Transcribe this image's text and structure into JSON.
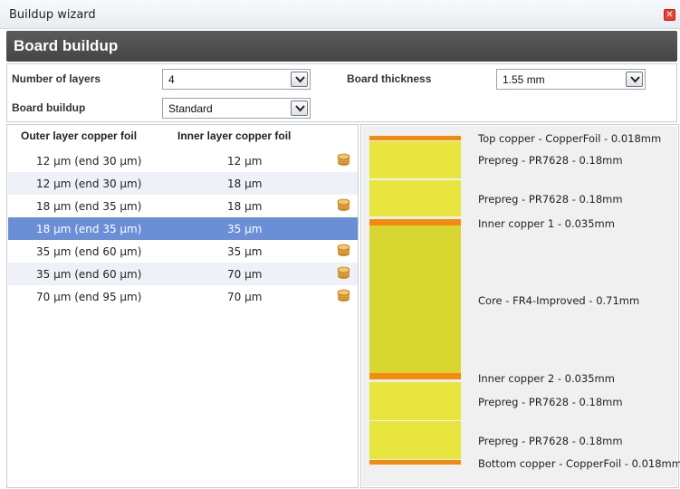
{
  "window": {
    "title": "Buildup wizard",
    "close_icon": "close-icon"
  },
  "header": {
    "title": "Board buildup"
  },
  "settings": {
    "layers_label": "Number of layers",
    "layers_value": "4",
    "thickness_label": "Board thickness",
    "thickness_value": "1.55 mm",
    "buildup_label": "Board buildup",
    "buildup_value": "Standard"
  },
  "table": {
    "headers": [
      "Outer layer copper foil",
      "Inner layer copper foil"
    ],
    "rows": [
      {
        "outer": "12 µm (end 30 µm)",
        "inner": "12 µm",
        "coin": true,
        "selected": false
      },
      {
        "outer": "12 µm (end 30 µm)",
        "inner": "18 µm",
        "coin": false,
        "selected": false
      },
      {
        "outer": "18 µm (end 35 µm)",
        "inner": "18 µm",
        "coin": true,
        "selected": false
      },
      {
        "outer": "18 µm (end 35 µm)",
        "inner": "35 µm",
        "coin": false,
        "selected": true
      },
      {
        "outer": "35 µm (end 60 µm)",
        "inner": "35 µm",
        "coin": true,
        "selected": false
      },
      {
        "outer": "35 µm (end 60 µm)",
        "inner": "70 µm",
        "coin": true,
        "selected": false
      },
      {
        "outer": "70 µm (end 95 µm)",
        "inner": "70 µm",
        "coin": true,
        "selected": false
      }
    ]
  },
  "stackup": {
    "colors": {
      "copper": "#f58a11",
      "prepreg": "#e7e53e",
      "core": "#d8d631"
    },
    "layers": [
      "Top copper - CopperFoil - 0.018mm",
      "Prepreg - PR7628 - 0.18mm",
      "Prepreg - PR7628 - 0.18mm",
      "Inner copper 1 - 0.035mm",
      "Core - FR4-Improved - 0.71mm",
      "Inner copper 2 - 0.035mm",
      "Prepreg - PR7628 - 0.18mm",
      "Prepreg - PR7628 - 0.18mm",
      "Bottom copper - CopperFoil - 0.018mm"
    ]
  }
}
